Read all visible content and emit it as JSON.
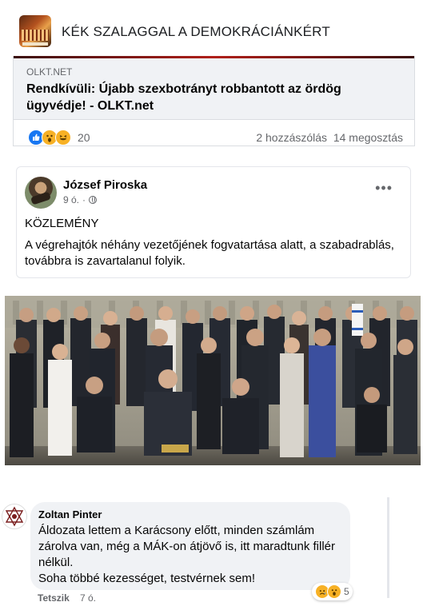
{
  "group": {
    "name": "KÉK SZALAGGAL A DEMOKRÁCIÁNKÉRT"
  },
  "shared_link": {
    "domain": "OLKT.NET",
    "title": "Rendkívüli: Újabb szexbotrányt robbantott az ördög ügyvédje! - OLKT.net",
    "reactions": [
      "like",
      "wow",
      "haha"
    ],
    "reaction_count": "20",
    "comments": "2 hozzászólás",
    "shares": "14 megosztás"
  },
  "post": {
    "author": "József Piroska",
    "time": "9 ó.",
    "more_label": "•••",
    "heading": "KÖZLEMÉNY",
    "text": "A végrehajtók néhány vezetőjének fogvatartása alatt, a szabadrablás, továbbra is zavartalanul folyik."
  },
  "comment": {
    "author": "Zoltan Pinter",
    "text": "Áldozata lettem a Karácsony előtt, minden számlám zárolva van, még a MÁK-on átjövő is, itt maradtunk fillér nélkül.\nSoha többé kezességet, testvérnek sem!",
    "reactions": [
      "sad",
      "wow"
    ],
    "reaction_count": "5",
    "like_label": "Tetszik",
    "time": "7 ó."
  },
  "icons": {
    "like": "thumbs-up-icon",
    "wow": "wow-face-icon",
    "haha": "haha-face-icon",
    "sad": "sad-face-icon",
    "privacy": "globe-icon"
  },
  "colors": {
    "facebook_blue": "#1877f2",
    "reaction_yellow": "#f7b125",
    "muted_text": "#65676b",
    "bubble_bg": "#f0f2f5"
  }
}
